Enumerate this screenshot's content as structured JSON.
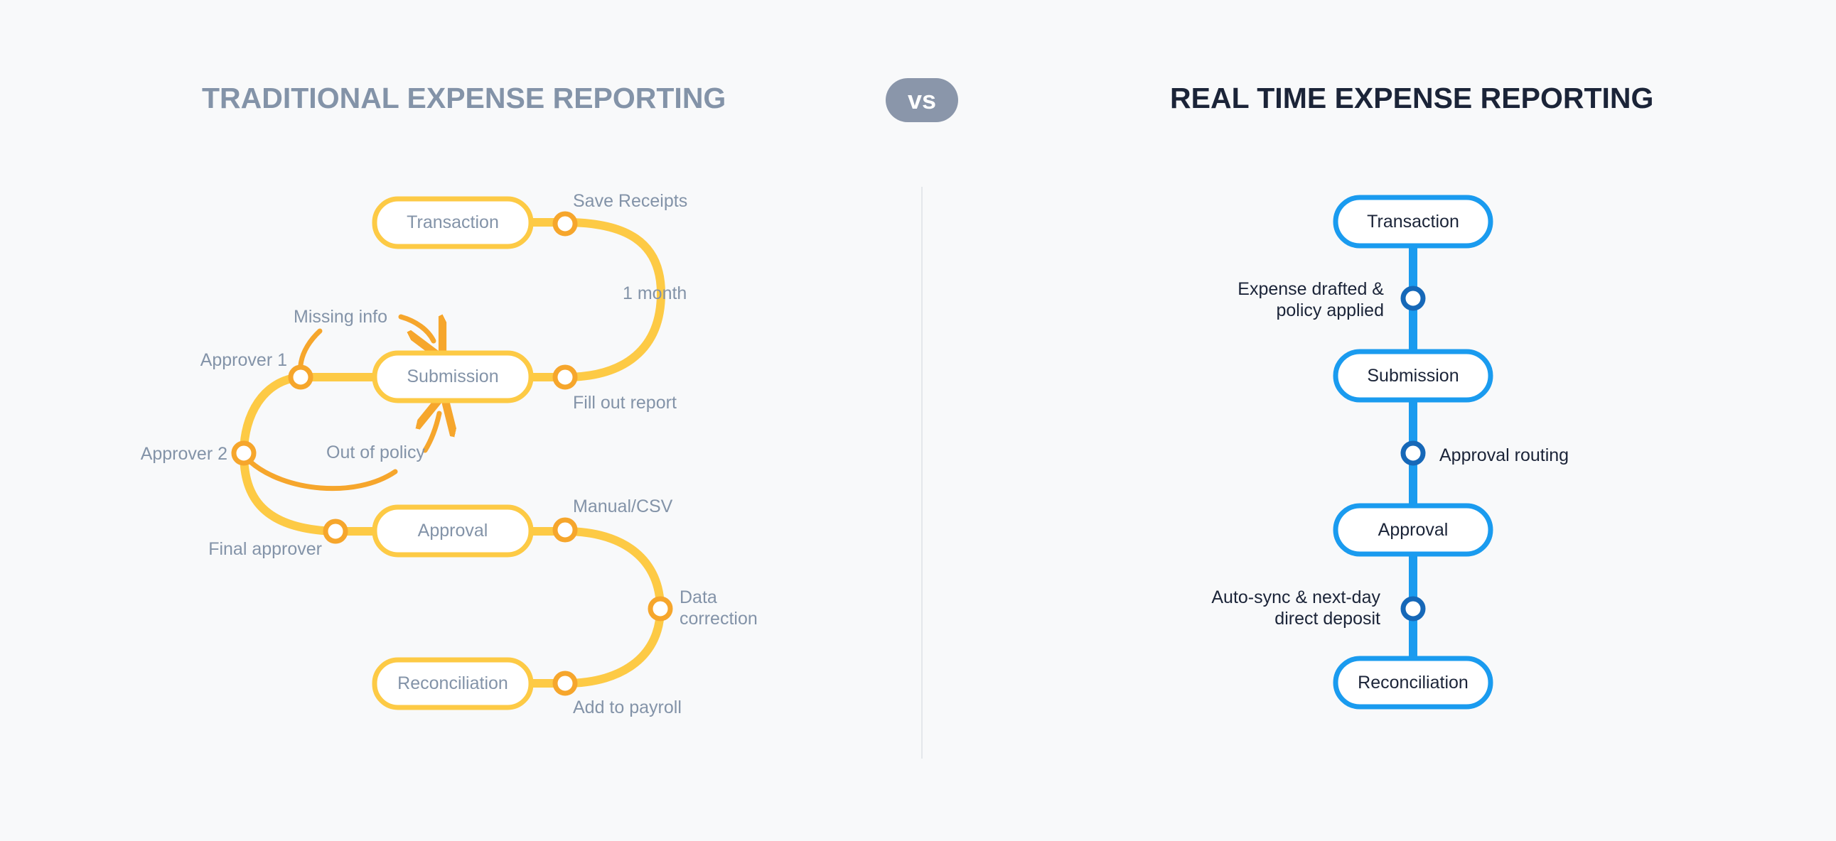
{
  "header": {
    "left_title": "TRADITIONAL EXPENSE REPORTING",
    "vs": "vs",
    "right_title": "REAL TIME EXPENSE REPORTING"
  },
  "traditional": {
    "color": "#fdca45",
    "accent": "#f6a62c",
    "nodes": [
      "Transaction",
      "Submission",
      "Approval",
      "Reconciliation"
    ],
    "labels": {
      "save_receipts": "Save Receipts",
      "one_month": "1 month",
      "fill_out_report": "Fill out report",
      "missing_info": "Missing info",
      "approver_1": "Approver 1",
      "approver_2": "Approver 2",
      "out_of_policy": "Out of policy",
      "final_approver": "Final approver",
      "manual_csv": "Manual/CSV",
      "data_correction_1": "Data",
      "data_correction_2": "correction",
      "add_to_payroll": "Add to payroll"
    }
  },
  "realtime": {
    "color": "#1a9bef",
    "accent": "#1668b8",
    "nodes": [
      "Transaction",
      "Submission",
      "Approval",
      "Reconciliation"
    ],
    "labels": {
      "drafted_1": "Expense drafted &",
      "drafted_2": "policy applied",
      "approval_routing": "Approval routing",
      "autosync_1": "Auto-sync & next-day",
      "autosync_2": "direct deposit"
    }
  }
}
